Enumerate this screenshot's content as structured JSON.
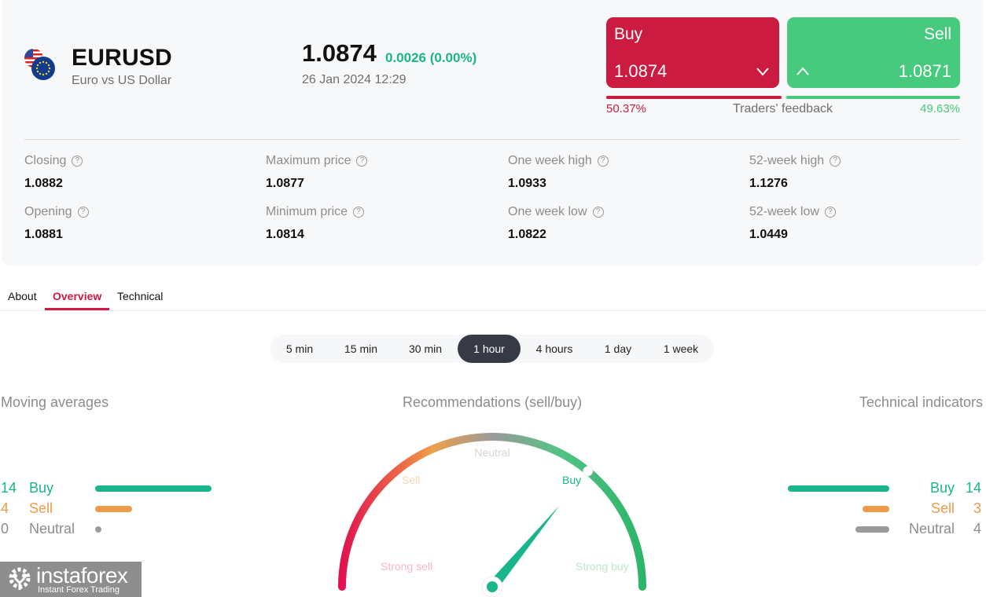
{
  "instrument": {
    "symbol": "EURUSD",
    "description": "Euro vs US Dollar",
    "price": "1.0874",
    "change": "0.0026 (0.00%)",
    "datetime": "26 Jan 2024 12:29"
  },
  "trade": {
    "buy_label": "Buy",
    "buy_price": "1.0874",
    "sell_label": "Sell",
    "sell_price": "1.0871",
    "feedback_label": "Traders' feedback",
    "buy_percent": "50.37%",
    "sell_percent": "49.63%",
    "buy_fraction": 0.5037
  },
  "stats": [
    {
      "label": "Closing",
      "value": "1.0882"
    },
    {
      "label": "Opening",
      "value": "1.0881"
    },
    {
      "label": "Maximum price",
      "value": "1.0877"
    },
    {
      "label": "Minimum price",
      "value": "1.0814"
    },
    {
      "label": "One week high",
      "value": "1.0933"
    },
    {
      "label": "One week low",
      "value": "1.0822"
    },
    {
      "label": "52-week high",
      "value": "1.1276"
    },
    {
      "label": "52-week low",
      "value": "1.0449"
    }
  ],
  "tabs": [
    {
      "label": "About",
      "active": false
    },
    {
      "label": "Overview",
      "active": true
    },
    {
      "label": "Technical",
      "active": false
    }
  ],
  "timeframes": [
    {
      "label": "5 min",
      "active": false
    },
    {
      "label": "15 min",
      "active": false
    },
    {
      "label": "30 min",
      "active": false
    },
    {
      "label": "1 hour",
      "active": true
    },
    {
      "label": "4 hours",
      "active": false
    },
    {
      "label": "1 day",
      "active": false
    },
    {
      "label": "1 week",
      "active": false
    }
  ],
  "moving_averages": {
    "title": "Moving averages",
    "rows": [
      {
        "count": "14",
        "label": "Buy"
      },
      {
        "count": "4",
        "label": "Sell"
      },
      {
        "count": "0",
        "label": "Neutral"
      }
    ]
  },
  "technical_indicators": {
    "title": "Technical indicators",
    "rows": [
      {
        "count": "14",
        "label": "Buy"
      },
      {
        "count": "3",
        "label": "Sell"
      },
      {
        "count": "4",
        "label": "Neutral"
      }
    ]
  },
  "recommendation": {
    "title": "Recommendations (sell/buy)",
    "zones": [
      "Strong sell",
      "Sell",
      "Neutral",
      "Buy",
      "Strong buy"
    ],
    "current": "Buy",
    "needle_fraction": 0.72
  },
  "colors": {
    "buy_red": "#cc1b40",
    "sell_green": "#47c97e",
    "indicator_buy": "#19b58b",
    "indicator_sell": "#ee9a4a",
    "indicator_neutral": "#9a9a9a"
  },
  "branding": {
    "logo_name": "instaforex",
    "logo_tagline": "Instant Forex Trading"
  }
}
